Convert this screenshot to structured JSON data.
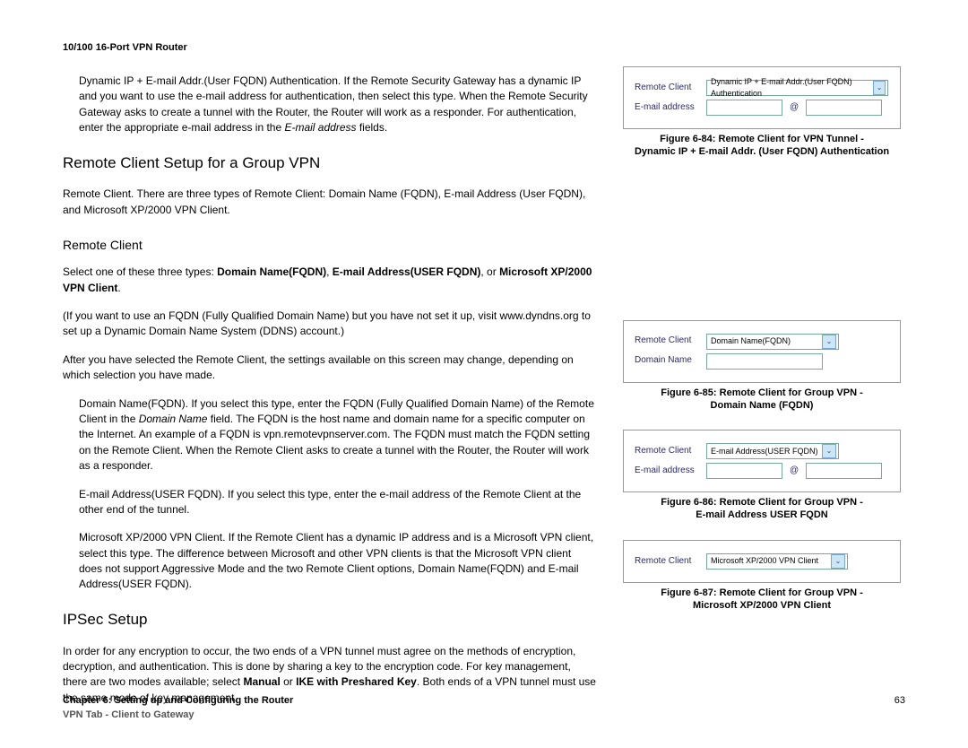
{
  "header": "10/100 16-Port VPN Router",
  "intro_p": "Dynamic IP + E-mail Addr.(User FQDN) Authentication. If the Remote Security Gateway has a dynamic IP and you want to use the e-mail address for authentication, then select this type. When the Remote Security Gateway asks to create a tunnel with the Router, the Router will work as a responder. For authentication, enter the appropriate e-mail address in the ",
  "intro_p_ital": "E-mail address",
  "intro_p_end": " fields.",
  "h2_remote": "Remote Client Setup for a Group VPN",
  "p_remote_intro": "Remote Client. There are three types of Remote Client: Domain Name (FQDN), E-mail Address (User FQDN), and Microsoft XP/2000 VPN Client.",
  "h3_remote": "Remote Client",
  "p_select_pre": "Select one of these three types: ",
  "bold1": "Domain Name(FQDN)",
  "comma1": ", ",
  "bold2": "E-mail Address(USER FQDN)",
  "comma2": ", or ",
  "bold3": "Microsoft XP/2000 VPN Client",
  "period": ".",
  "p_fqdn_note": "(If you want to use an FQDN (Fully Qualified Domain Name) but you have not set it up, visit www.dyndns.org to set up a Dynamic Domain Name System (DDNS) account.)",
  "p_after_select": "After you have selected the Remote Client, the settings available on this screen may change, depending on which selection you have made.",
  "p_dn_pre": "Domain Name(FQDN). If you select this type, enter the FQDN (Fully Qualified Domain Name) of the Remote Client in the ",
  "p_dn_ital": "Domain Name",
  "p_dn_post": " field. The FQDN is the host name and domain name for a specific computer on the Internet. An example of a FQDN is vpn.remotevpnserver.com. The FQDN must match the FQDN setting on the Remote Client. When the Remote Client asks to create a tunnel with the Router, the Router will work as a responder.",
  "p_email": "E-mail Address(USER FQDN). If you select this type, enter the e-mail address of the Remote Client at the other end of the tunnel.",
  "p_ms": "Microsoft XP/2000 VPN Client. If the Remote Client has a dynamic IP address and is a Microsoft VPN client, select this type. The difference between Microsoft and other VPN clients is that the Microsoft VPN client does not support Aggressive Mode and the two Remote Client options, Domain Name(FQDN) and E-mail Address(USER FQDN).",
  "h2_ipsec": "IPSec Setup",
  "p_ipsec_pre": "In order for any encryption to occur, the two ends of a VPN tunnel must agree on the methods of encryption, decryption, and authentication. This is done by sharing a key to the encryption code. For key management, there are two modes available; select ",
  "p_ipsec_b1": "Manual",
  "p_ipsec_mid": " or ",
  "p_ipsec_b2": "IKE with Preshared Key",
  "p_ipsec_post": ". Both ends of a VPN tunnel must use the same mode of key management.",
  "fig84": {
    "label_rc": "Remote Client",
    "select_val": "Dynamic IP + E-mail Addr.(User FQDN) Authentication",
    "label_email": "E-mail address",
    "at": "@",
    "caption_l1": "Figure 6-84: Remote Client for VPN Tunnel -",
    "caption_l2": "Dynamic IP + E-mail Addr. (User FQDN) Authentication"
  },
  "fig85": {
    "label_rc": "Remote Client",
    "select_val": "Domain Name(FQDN)",
    "label_dn": "Domain Name",
    "caption_l1": "Figure 6-85: Remote Client for Group VPN -",
    "caption_l2": "Domain Name (FQDN)"
  },
  "fig86": {
    "label_rc": "Remote Client",
    "select_val": "E-mail Address(USER FQDN)",
    "label_email": "E-mail address",
    "at": "@",
    "caption_l1": "Figure 6-86: Remote Client for Group VPN -",
    "caption_l2": "E-mail Address USER FQDN"
  },
  "fig87": {
    "label_rc": "Remote Client",
    "select_val": "Microsoft XP/2000 VPN Client",
    "caption_l1": "Figure 6-87: Remote Client for Group VPN -",
    "caption_l2": "Microsoft XP/2000 VPN Client"
  },
  "footer": {
    "l1": "Chapter 6: Setting up and Configuring the Router",
    "l2": "VPN Tab - Client to Gateway",
    "page": "63"
  }
}
